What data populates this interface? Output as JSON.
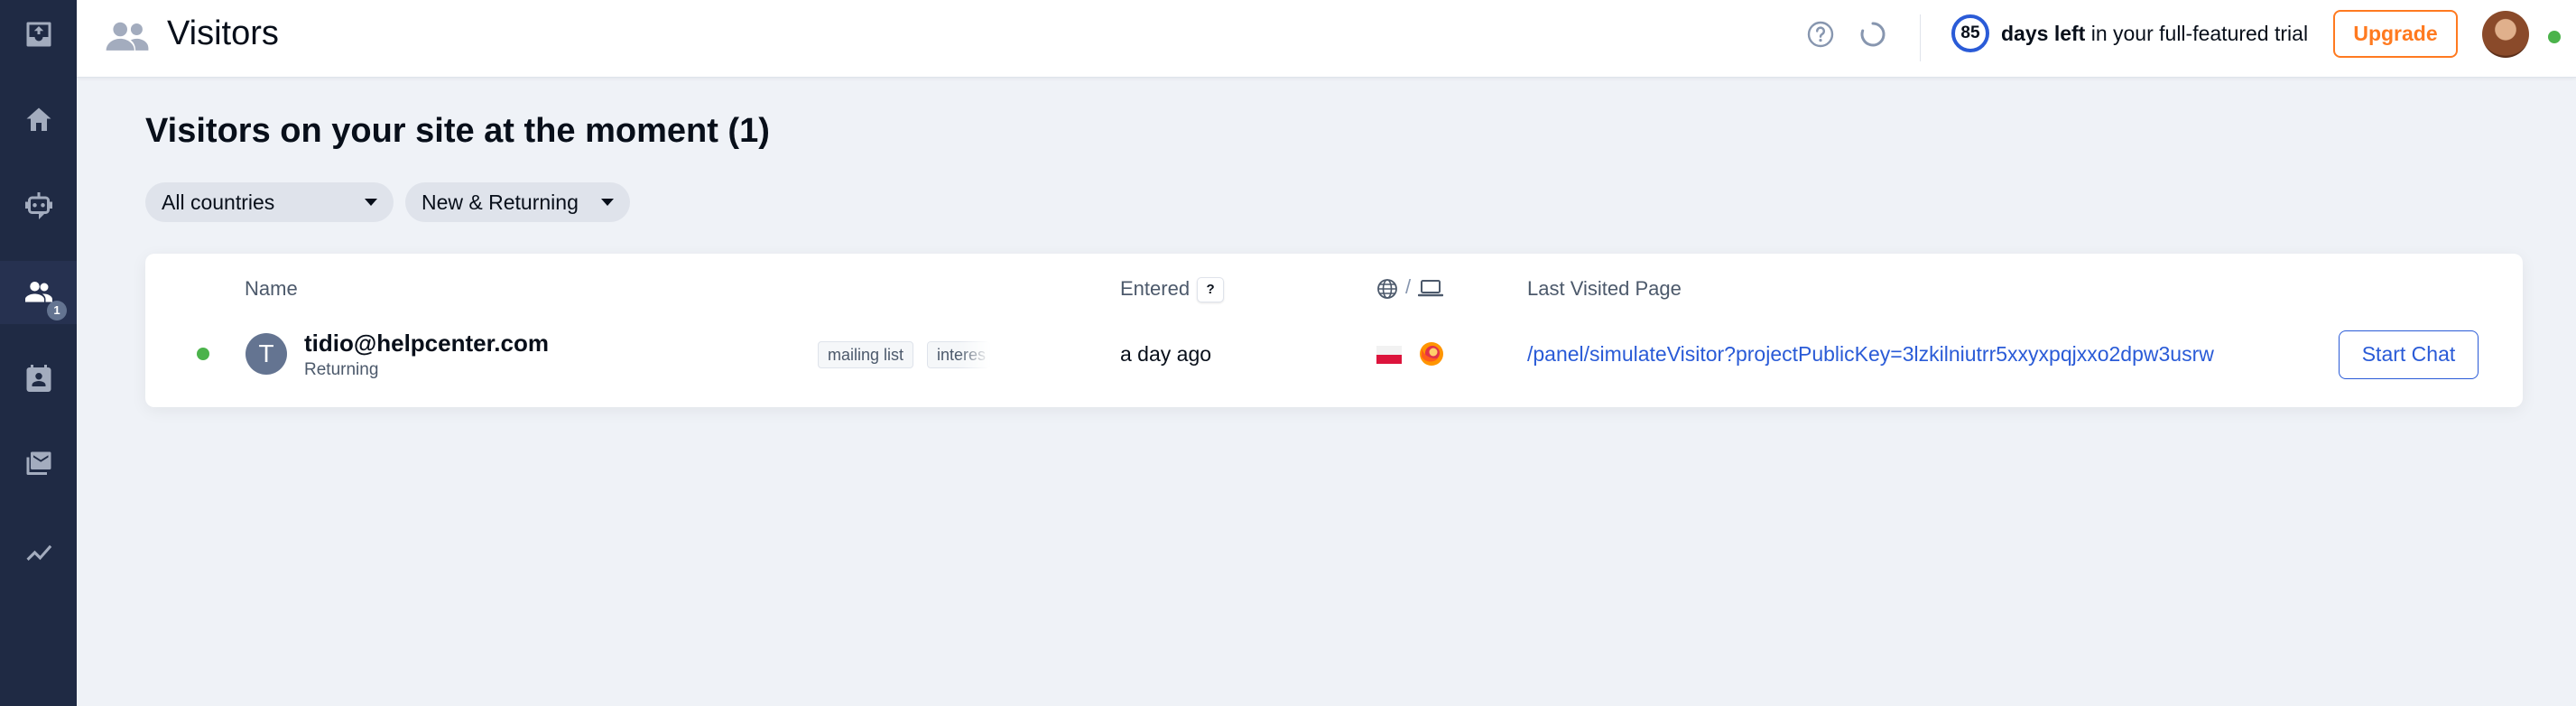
{
  "header": {
    "title": "Visitors",
    "trial_days": "85",
    "trial_bold": "days left",
    "trial_rest": " in your full-featured trial",
    "upgrade_label": "Upgrade"
  },
  "sidebar": {
    "items": [
      {
        "icon": "inbox-icon"
      },
      {
        "icon": "home-icon"
      },
      {
        "icon": "bot-icon"
      },
      {
        "icon": "visitors-icon",
        "badge": "1",
        "active": true
      },
      {
        "icon": "contacts-icon"
      },
      {
        "icon": "mail-icon"
      },
      {
        "icon": "analytics-icon"
      }
    ]
  },
  "main": {
    "heading": "Visitors on your site at the moment (1)",
    "filters": {
      "country": "All countries",
      "visitor_type": "New & Returning"
    },
    "table": {
      "columns": {
        "name": "Name",
        "entered": "Entered",
        "entered_help": "?",
        "location_device_sep": "/",
        "last_visited": "Last Visited Page"
      },
      "rows": [
        {
          "avatar_letter": "T",
          "email": "tidio@helpcenter.com",
          "type": "Returning",
          "tags": [
            "mailing list",
            "interes"
          ],
          "entered": "a day ago",
          "last_visited_page": "/panel/simulateVisitor?projectPublicKey=3lzkilniutrr5xxyxpqjxxo2dpw3usrw",
          "action": "Start Chat"
        }
      ]
    }
  },
  "colors": {
    "sidebar_bg": "#1f2a44",
    "accent_blue": "#2a5bd7",
    "upgrade_orange": "#ff7a20",
    "online_green": "#4bb34b"
  }
}
